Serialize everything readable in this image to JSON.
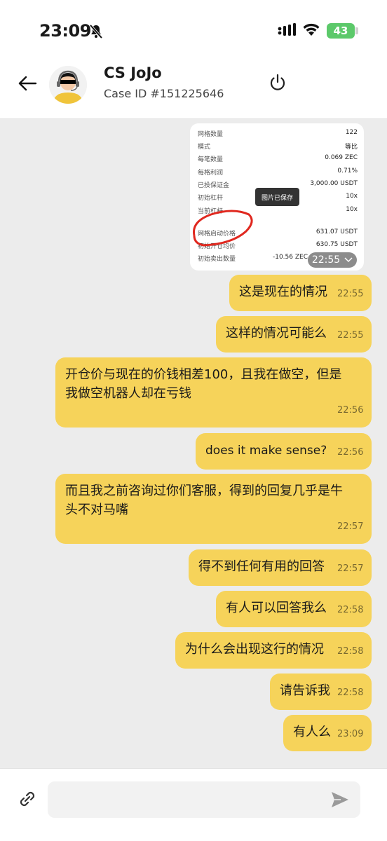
{
  "status_bar": {
    "time": "23:09",
    "battery": "43"
  },
  "header": {
    "agent_name": "CS JoJo",
    "case_id": "Case ID #151225646"
  },
  "image_message": {
    "rows": [
      {
        "k": "网格数量",
        "v": "122"
      },
      {
        "k": "模式",
        "v": "等比"
      },
      {
        "k": "每笔数量",
        "v": "0.069 ZEC"
      },
      {
        "k": "每格利润",
        "v": "0.71%"
      },
      {
        "k": "已投保证金",
        "v": "3,000.00 USDT"
      },
      {
        "k": "初始杠杆",
        "v": "10x"
      },
      {
        "k": "当前杠杆",
        "v": "10x"
      },
      {
        "k": "网格启动价格",
        "v": "631.07 USDT"
      },
      {
        "k": "初始开仓均价",
        "v": "630.75 USDT"
      },
      {
        "k": "初始卖出数量",
        "v": "-10.56 ZEC"
      }
    ],
    "toast": "图片已保存",
    "time": "22:55"
  },
  "messages": [
    {
      "text": "这是现在的情况",
      "time": "22:55"
    },
    {
      "text": "这样的情况可能么",
      "time": "22:55"
    },
    {
      "text_lines": [
        "开仓价与现在的价钱相差100，且我在做空，但是",
        "我做空机器人却在亏钱"
      ],
      "time": "22:56"
    },
    {
      "text": "does it make sense?",
      "time": "22:56"
    },
    {
      "text_lines": [
        "而且我之前咨询过你们客服，得到的回复几乎是牛",
        "头不对马嘴"
      ],
      "time": "22:57"
    },
    {
      "text": "得不到任何有用的回答",
      "time": "22:57"
    },
    {
      "text": "有人可以回答我么",
      "time": "22:58"
    },
    {
      "text": "为什么会出现这行的情况",
      "time": "22:58"
    },
    {
      "text": "请告诉我",
      "time": "22:58"
    },
    {
      "text": "有人么",
      "time": "23:09"
    }
  ],
  "composer": {
    "placeholder": ""
  },
  "colors": {
    "bubble": "#f6d35a",
    "background": "#ececec"
  }
}
